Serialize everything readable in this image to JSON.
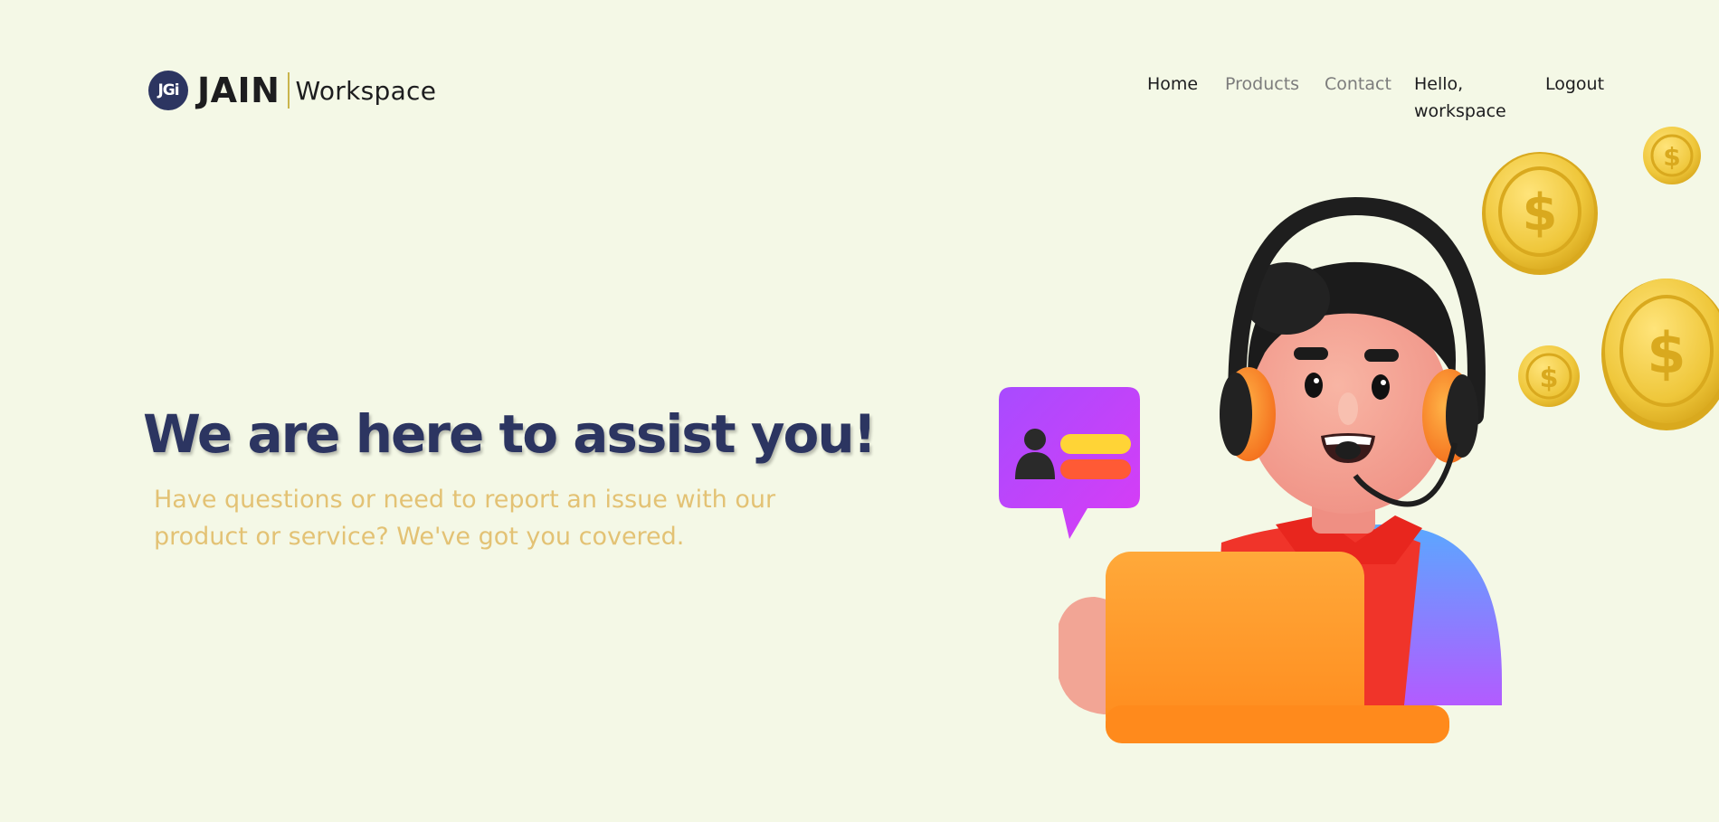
{
  "header": {
    "logo_badge": "JGi",
    "brand": "JAIN",
    "brand_sub": "Workspace"
  },
  "nav": {
    "home": "Home",
    "products": "Products",
    "contact": "Contact",
    "greeting": "Hello, workspace",
    "logout": "Logout"
  },
  "hero": {
    "title": "We are here to assist you!",
    "subtitle": "Have questions or need to report an issue with our product or service? We've got you covered."
  },
  "colors": {
    "background": "#f4f8e6",
    "title": "#2c3561",
    "subtitle": "#e3c274",
    "nav_active": "#1d1d1f",
    "nav_muted": "#7c7c7c"
  },
  "illustration": {
    "subject": "support-agent-with-headset-and-laptop"
  }
}
